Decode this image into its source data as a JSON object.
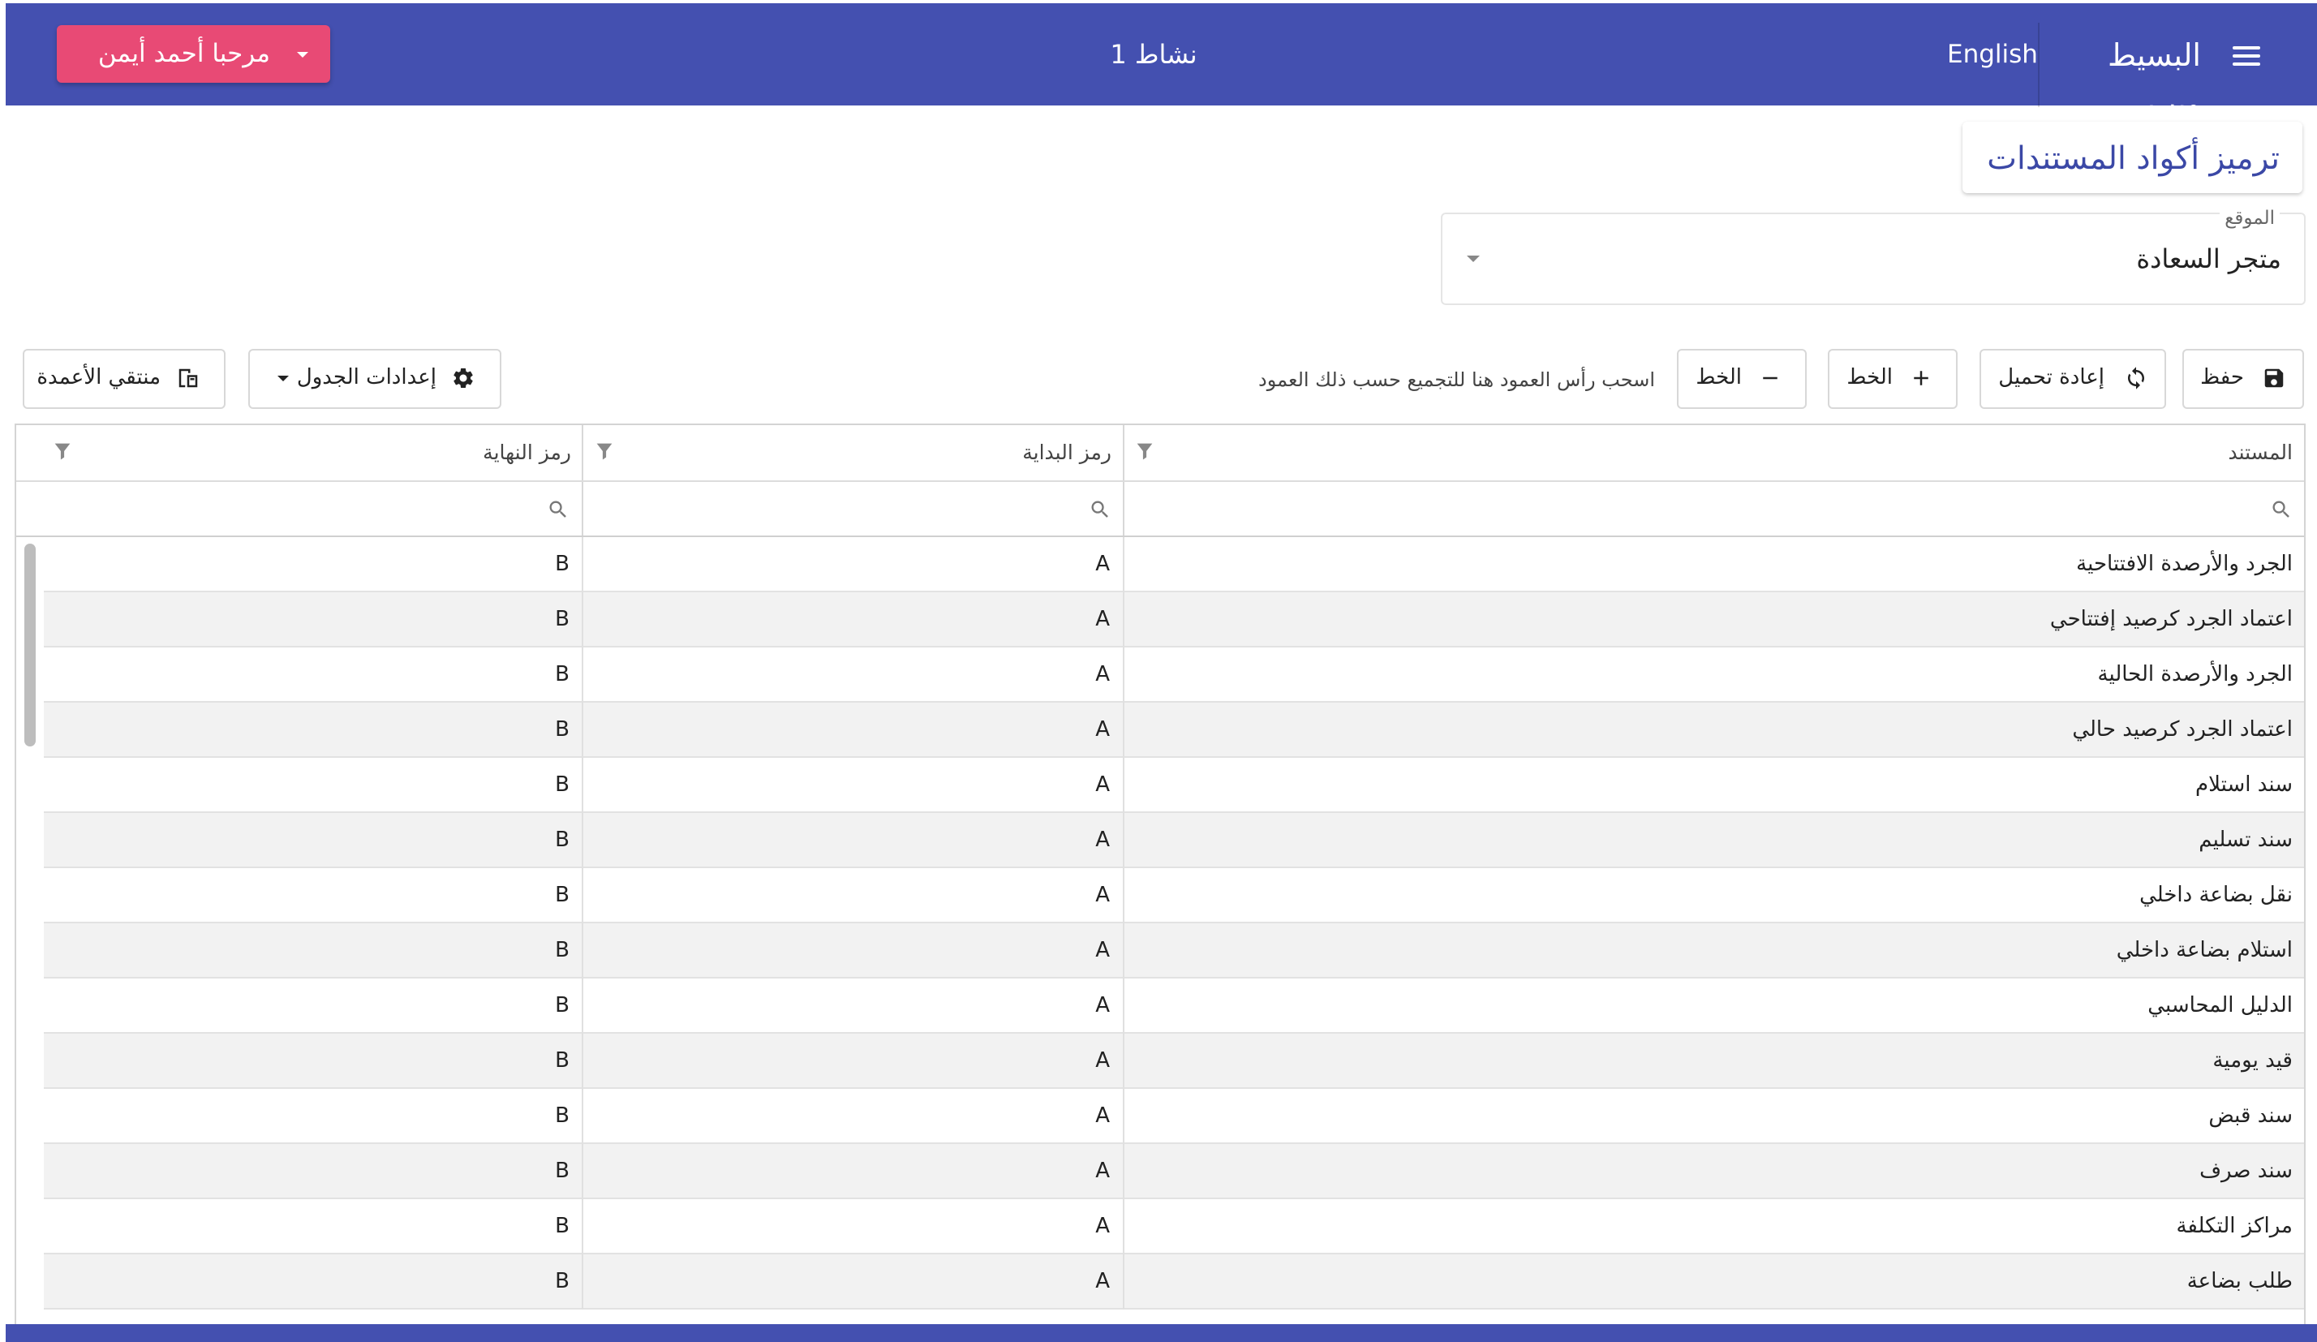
{
  "header": {
    "brand": "البسيط ويب",
    "language": "English",
    "activity": "نشاط 1",
    "user_button": "مرحبا أحمد أيمن",
    "color": "#4450b0",
    "accent": "#e84a75"
  },
  "page": {
    "title": "ترميز أكواد المستندات"
  },
  "location": {
    "label": "الموقع",
    "value": "متجر السعادة"
  },
  "toolbar": {
    "save": "حفظ",
    "reload": "إعادة تحميل",
    "add_line": "الخط",
    "remove_line": "الخط",
    "group_hint": "اسحب رأس العمود هنا للتجميع حسب ذلك العمود",
    "table_settings": "إعدادات الجدول",
    "column_chooser": "منتقي الأعمدة"
  },
  "grid": {
    "columns": [
      "المستند",
      "رمز البداية",
      "رمز النهاية"
    ],
    "rows": [
      [
        "الجرد والأرصدة الافتتاحية",
        "A",
        "B"
      ],
      [
        "اعتماد الجرد كرصيد إفتتاحي",
        "A",
        "B"
      ],
      [
        "الجرد والأرصدة الحالية",
        "A",
        "B"
      ],
      [
        "اعتماد الجرد كرصيد حالي",
        "A",
        "B"
      ],
      [
        "سند استلام",
        "A",
        "B"
      ],
      [
        "سند تسليم",
        "A",
        "B"
      ],
      [
        "نقل بضاعة داخلي",
        "A",
        "B"
      ],
      [
        "استلام بضاعة داخلي",
        "A",
        "B"
      ],
      [
        "الدليل المحاسبي",
        "A",
        "B"
      ],
      [
        "قيد يومية",
        "A",
        "B"
      ],
      [
        "سند قبض",
        "A",
        "B"
      ],
      [
        "سند صرف",
        "A",
        "B"
      ],
      [
        "مراكز التكلفة",
        "A",
        "B"
      ],
      [
        "طلب بضاعة",
        "A",
        "B"
      ]
    ]
  }
}
